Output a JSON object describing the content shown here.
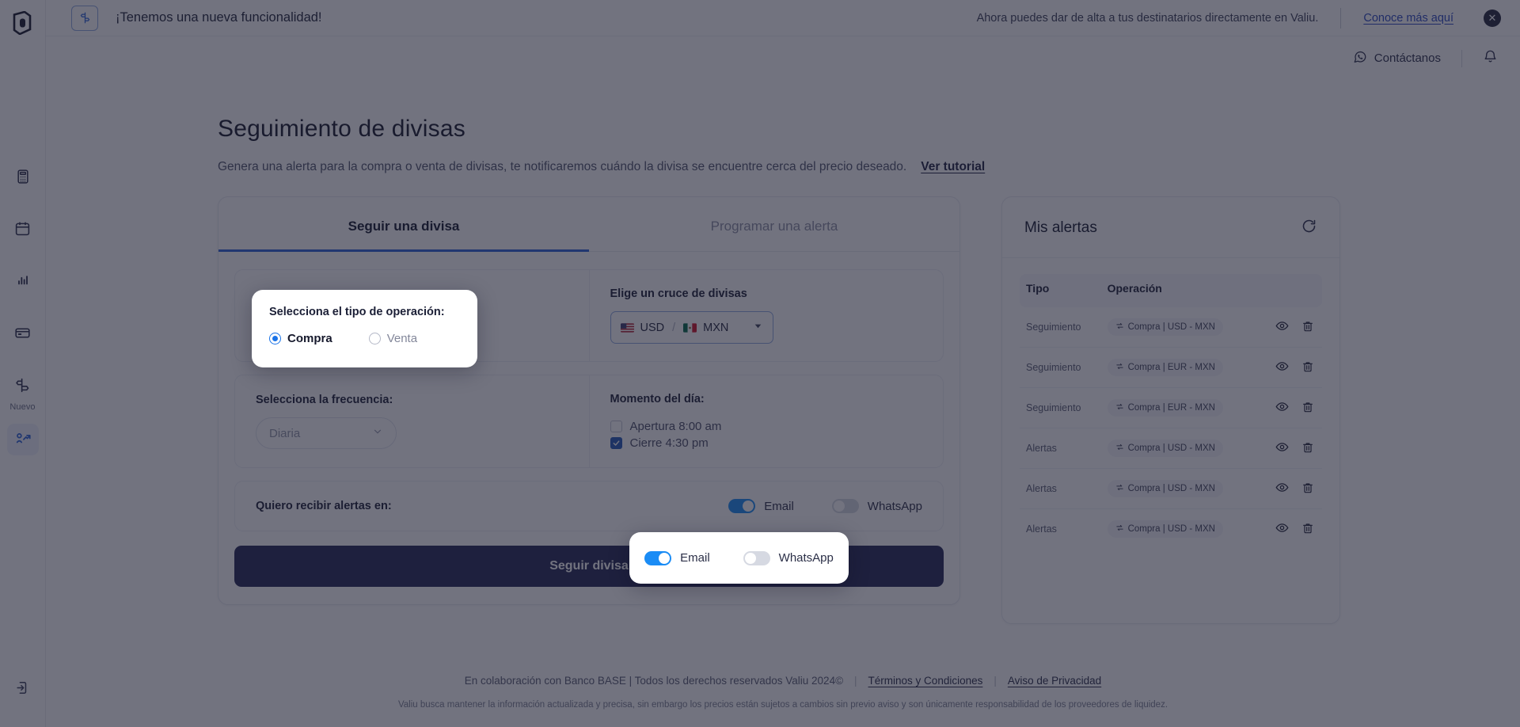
{
  "banner": {
    "title": "¡Tenemos una nueva funcionalidad!",
    "message": "Ahora puedes dar de alta a tus destinatarios directamente en Valiu.",
    "link": "Conoce más aquí",
    "close": "✕",
    "icon": "signpost-icon"
  },
  "topbar": {
    "contact": "Contáctanos",
    "whatsapp_icon": "whatsapp-icon",
    "bell_icon": "bell-icon"
  },
  "sidebar": {
    "brand": "valiu-logo",
    "items": [
      {
        "name": "calculator-icon",
        "label": "",
        "active": false
      },
      {
        "name": "calendar-icon",
        "label": "",
        "active": false
      },
      {
        "name": "bar-chart-icon",
        "label": "",
        "active": false
      },
      {
        "name": "credit-card-icon",
        "label": "",
        "active": false
      },
      {
        "name": "signpost-icon",
        "label": "Nuevo",
        "active": false
      },
      {
        "name": "currency-trend-icon",
        "label": "",
        "active": true
      }
    ],
    "logout_icon": "logout-icon"
  },
  "page": {
    "title": "Seguimiento de divisas",
    "subtitle": "Genera una alerta para la compra o venta de divisas, te notificaremos cuándo la divisa se encuentre cerca del precio deseado.",
    "tutorial_link": "Ver tutorial"
  },
  "tabs": [
    {
      "label": "Seguir una divisa",
      "active": true
    },
    {
      "label": "Programar una alerta",
      "active": false
    }
  ],
  "form": {
    "operation": {
      "label": "Selecciona el tipo de operación:",
      "options": [
        {
          "label": "Compra",
          "selected": true
        },
        {
          "label": "Venta",
          "selected": false
        }
      ]
    },
    "pair": {
      "label": "Elige un cruce de divisas",
      "base": "USD",
      "quote": "MXN",
      "separator": "/",
      "base_flag": "us-flag-icon",
      "quote_flag": "mx-flag-icon",
      "caret_icon": "chevron-down-icon"
    },
    "frequency": {
      "label": "Selecciona la frecuencia:",
      "value": "Diaria",
      "caret_icon": "chevron-down-icon"
    },
    "moment": {
      "label": "Momento del día:",
      "options": [
        {
          "label": "Apertura 8:00 am",
          "checked": false
        },
        {
          "label": "Cierre 4:30 pm",
          "checked": true
        }
      ]
    },
    "notify": {
      "label": "Quiero recibir alertas en:",
      "channels": [
        {
          "label": "Email",
          "on": true
        },
        {
          "label": "WhatsApp",
          "on": false
        }
      ]
    },
    "submit": "Seguir divisa"
  },
  "alerts": {
    "title": "Mis alertas",
    "refresh_icon": "refresh-icon",
    "columns": [
      "Tipo",
      "Operación",
      ""
    ],
    "rows": [
      {
        "tipo": "Seguimiento",
        "operacion": "Compra | USD - MXN"
      },
      {
        "tipo": "Seguimiento",
        "operacion": "Compra | EUR - MXN"
      },
      {
        "tipo": "Seguimiento",
        "operacion": "Compra | EUR - MXN"
      },
      {
        "tipo": "Alertas",
        "operacion": "Compra | USD - MXN"
      },
      {
        "tipo": "Alertas",
        "operacion": "Compra | USD - MXN"
      },
      {
        "tipo": "Alertas",
        "operacion": "Compra | USD - MXN"
      }
    ],
    "view_icon": "eye-icon",
    "delete_icon": "trash-icon",
    "pill_icon": "exchange-arrows-icon"
  },
  "footer": {
    "copyright": "En colaboración con Banco BASE | Todos los derechos reservados Valiu 2024©",
    "terms": "Términos y Condiciones",
    "privacy": "Aviso de Privacidad",
    "separator": "|",
    "disclaimer": "Valiu busca mantener la información actualizada y precisa, sin embargo los precios están sujetos a cambios sin previo aviso y son únicamente responsabilidad de los proveedores de liquidez."
  },
  "colors": {
    "accent": "#2a63d8",
    "primary_button": "#232655",
    "toggle_on": "#1a8cf5",
    "checkbox_on": "#2358b8"
  }
}
